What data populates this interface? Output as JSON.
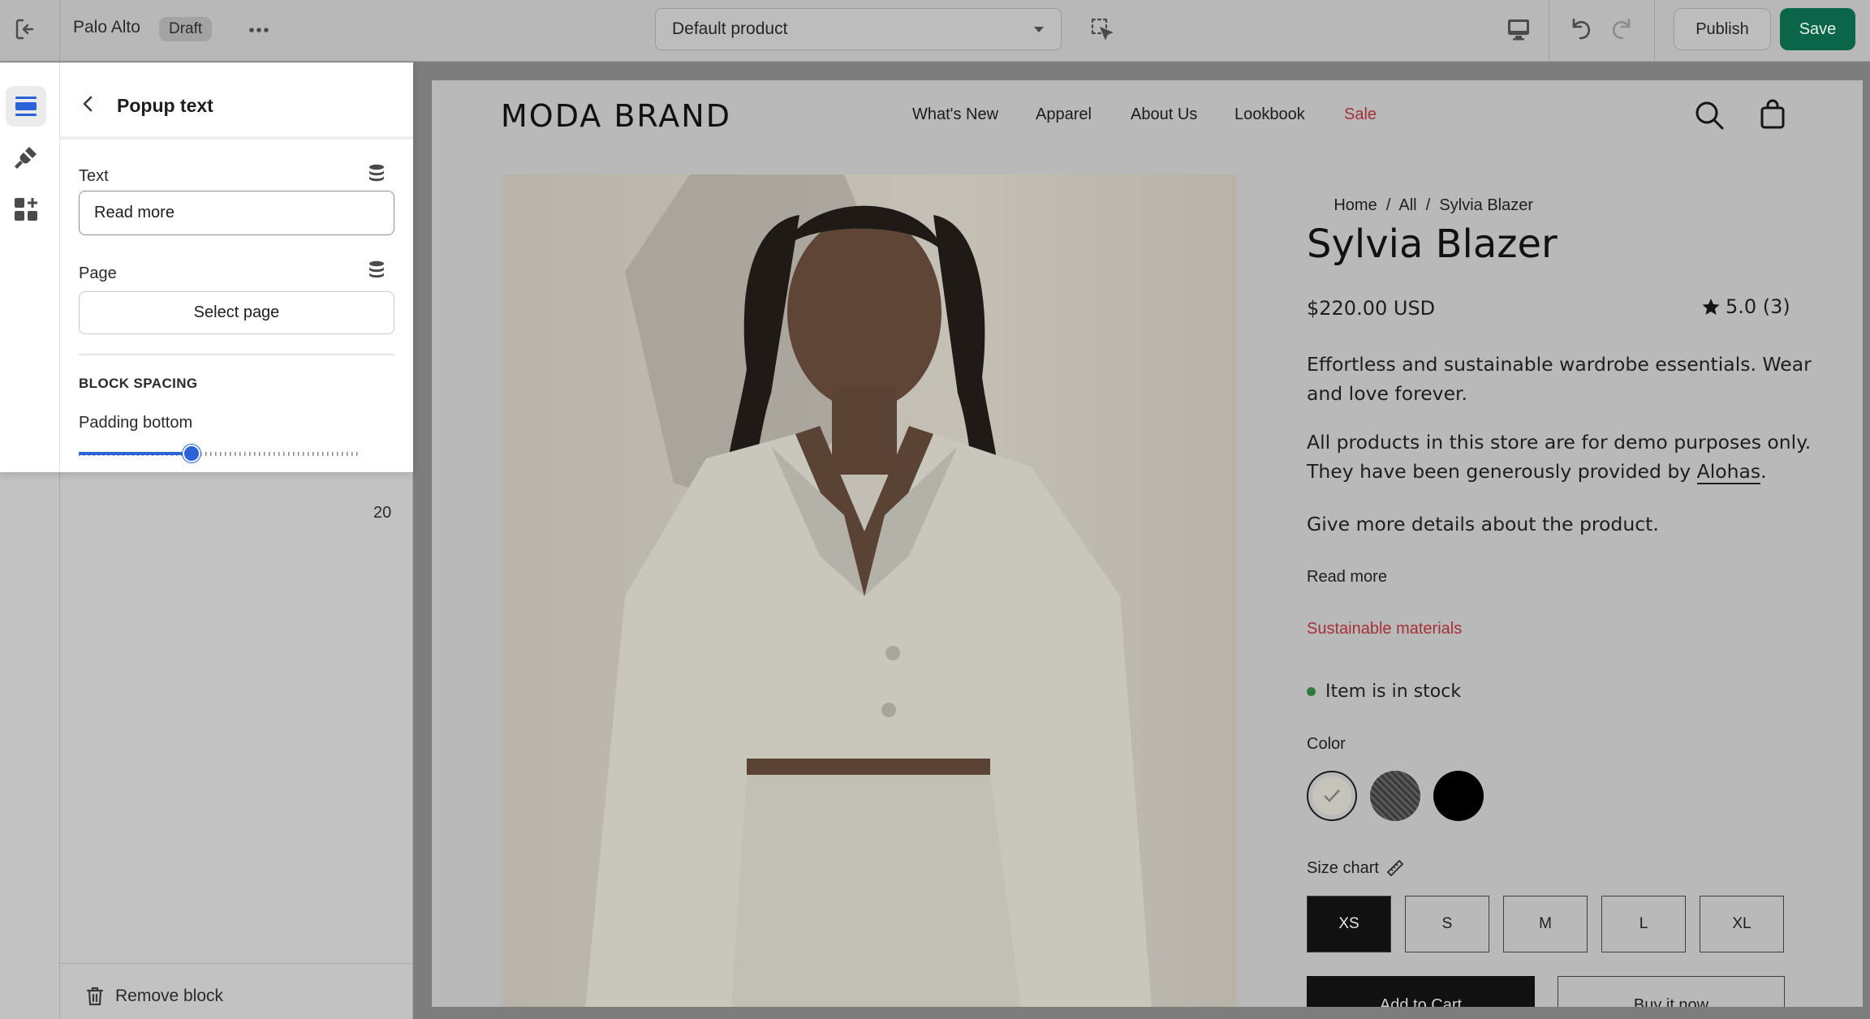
{
  "topbar": {
    "store_name": "Palo Alto",
    "status_badge": "Draft",
    "template_select": "Default product",
    "publish_label": "Publish",
    "save_label": "Save"
  },
  "popup": {
    "back_title": "Popup text",
    "text_label": "Text",
    "text_value": "Read more",
    "page_label": "Page",
    "page_button": "Select page",
    "section_heading": "BLOCK SPACING",
    "padding_label": "Padding bottom",
    "padding_value": "20",
    "padding_fraction": 0.4
  },
  "sidebar": {
    "remove_block": "Remove block"
  },
  "store": {
    "brand": "MODA BRAND",
    "nav": [
      "What's New",
      "Apparel",
      "About Us",
      "Lookbook",
      "Sale"
    ],
    "breadcrumb": [
      "Home",
      "All",
      "Sylvia Blazer"
    ],
    "product_title": "Sylvia Blazer",
    "price": "$220.00 USD",
    "rating": "5.0 (3)",
    "desc1a": "Effortless and sustainable wardrobe essentials. Wear",
    "desc1b": "and love forever.",
    "desc2a": "All products in this store are for demo purposes only.",
    "desc2b_prefix": "They have been generously provided by ",
    "desc2b_link": "Alohas",
    "desc2b_suffix": ".",
    "desc3": "Give more details about the product.",
    "read_more": "Read more",
    "sustainable": "Sustainable materials",
    "stock": "Item is in stock",
    "color_label": "Color",
    "size_chart": "Size chart",
    "sizes": [
      "XS",
      "S",
      "M",
      "L",
      "XL"
    ],
    "add_to_cart": "Add to Cart",
    "buy_now": "Buy it now"
  },
  "colors": {
    "save_green": "#0b6649",
    "sale_red": "#a3313a",
    "stock_green": "#2f7a3f",
    "slider_blue": "#2a62d9"
  }
}
